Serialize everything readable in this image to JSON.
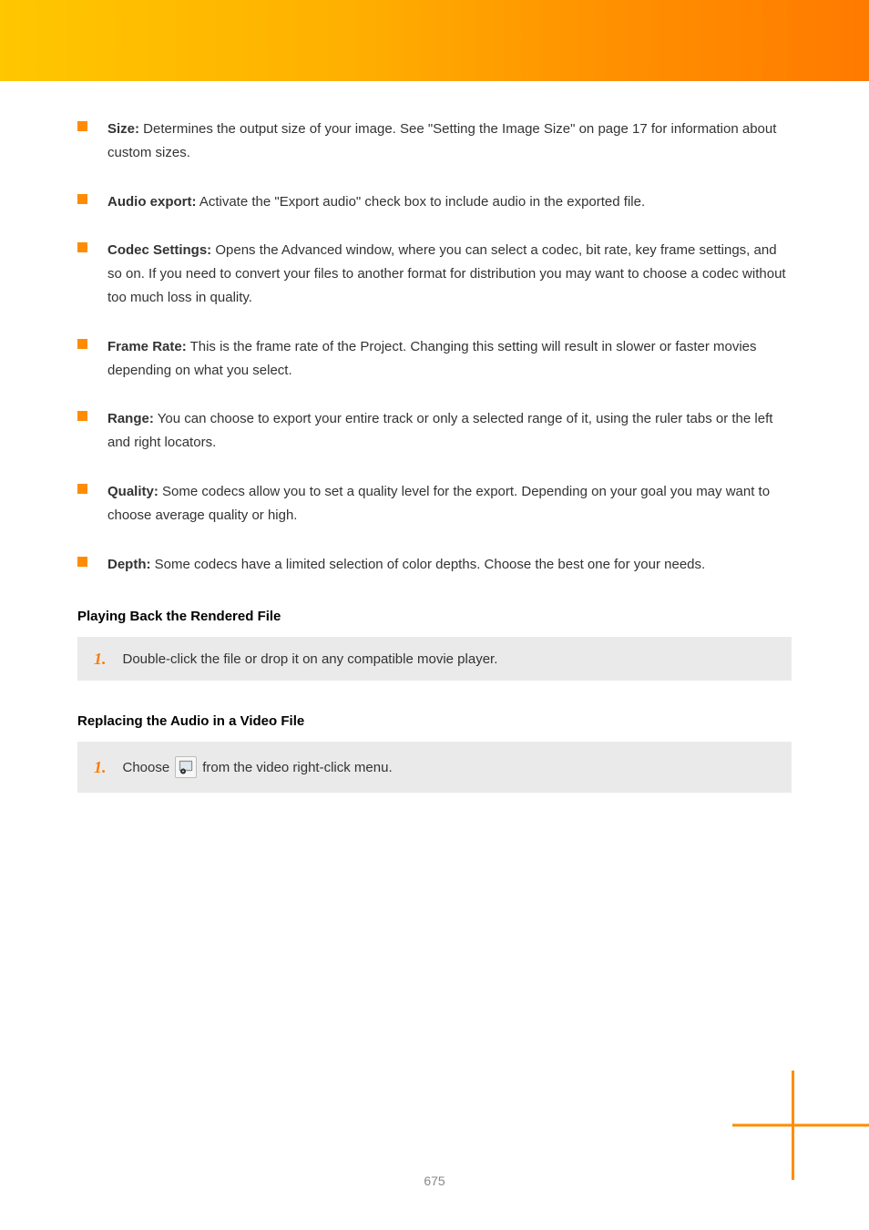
{
  "bullets": [
    {
      "title": "Size:",
      "body": " Determines the output size of your image. See \"Setting the Image Size\" on page 17 for information about custom sizes."
    },
    {
      "title": "Audio export:",
      "body": " Activate the \"Export audio\" check box to include audio in the exported file."
    },
    {
      "title": "Codec Settings:",
      "body": " Opens the Advanced window, where you can select a codec, bit rate, key frame settings, and so on. If you need to convert your files to another format for distribution you may want to choose a codec without too much loss in quality."
    },
    {
      "title": "Frame Rate:",
      "body": " This is the frame rate of the Project. Changing this setting will result in slower or faster movies depending on what you select."
    },
    {
      "title": "Range:",
      "body": " You can choose to export your entire track or only a selected range of it, using the ruler tabs or the left and right locators."
    },
    {
      "title": "Quality:",
      "body": " Some codecs allow you to set a quality level for the export. Depending on your goal you may want to choose average quality or high."
    },
    {
      "title": "Depth:",
      "body": " Some codecs have a limited selection of color depths. Choose the best one for your needs."
    }
  ],
  "sectionA": {
    "heading": "Playing Back the Rendered File",
    "step_num": "1.",
    "step_text": "Double-click the file or drop it on any compatible movie player."
  },
  "sectionB": {
    "heading": "Replacing the Audio in a Video File",
    "step_num": "1.",
    "step_pre": "Choose ",
    "step_icon_label": "replace-audio-icon",
    "step_post": " from the video right-click menu."
  },
  "pageNumber": "675"
}
